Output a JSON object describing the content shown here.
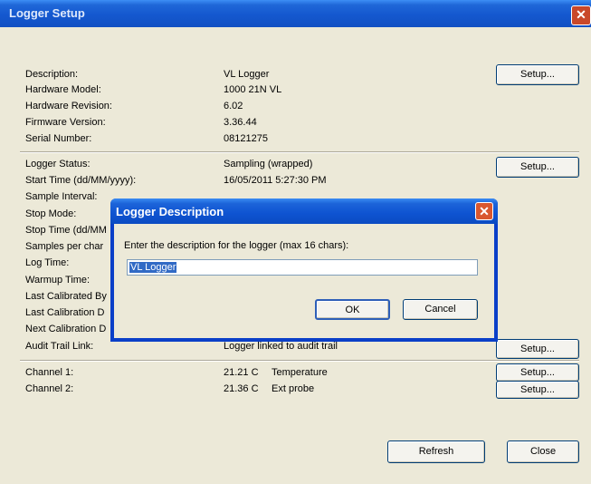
{
  "window": {
    "title": "Logger Setup",
    "close_glyph": "✕"
  },
  "info_section": {
    "rows": [
      {
        "label": "Description:",
        "value": "VL Logger"
      },
      {
        "label": "Hardware Model:",
        "value": "1000 21N VL"
      },
      {
        "label": "Hardware Revision:",
        "value": "6.02"
      },
      {
        "label": "Firmware Version:",
        "value": "3.36.44"
      },
      {
        "label": "Serial Number:",
        "value": "08121275"
      }
    ],
    "setup_label": "Setup..."
  },
  "status_section": {
    "rows": [
      {
        "label": "Logger Status:",
        "value": "Sampling (wrapped)"
      },
      {
        "label": "Start Time (dd/MM/yyyy):",
        "value": "16/05/2011 5:27:30 PM"
      },
      {
        "label": "Sample Interval:",
        "value": ""
      },
      {
        "label": "Stop Mode:",
        "value": ""
      },
      {
        "label": "Stop Time (dd/MM",
        "value": ""
      },
      {
        "label": "Samples per char",
        "value": ""
      },
      {
        "label": "Log Time:",
        "value": ""
      },
      {
        "label": "Warmup Time:",
        "value": ""
      },
      {
        "label": "Last Calibrated By",
        "value": ""
      },
      {
        "label": "Last Calibration D",
        "value": ""
      },
      {
        "label": "Next Calibration D",
        "value": ""
      },
      {
        "label": "Audit Trail Link:",
        "value": "Logger linked to audit trail"
      }
    ],
    "setup_label": "Setup...",
    "audit_setup_label": "Setup..."
  },
  "channels": [
    {
      "label": "Channel 1:",
      "value": "21.21 C",
      "name": "Temperature",
      "setup_label": "Setup..."
    },
    {
      "label": "Channel 2:",
      "value": "21.36 C",
      "name": "Ext probe",
      "setup_label": "Setup..."
    }
  ],
  "footer": {
    "refresh_label": "Refresh",
    "close_label": "Close"
  },
  "dialog": {
    "title": "Logger Description",
    "close_glyph": "✕",
    "prompt": "Enter the description for the logger (max 16 chars):",
    "input_value": "VL Logger",
    "ok_label": "OK",
    "cancel_label": "Cancel"
  }
}
